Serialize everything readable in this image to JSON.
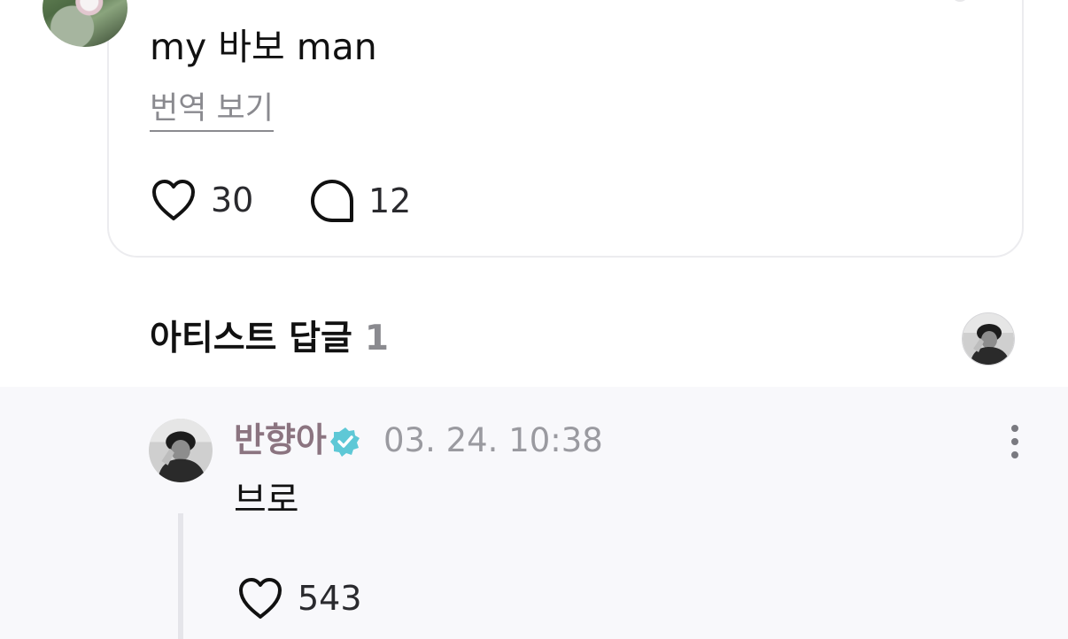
{
  "post": {
    "text": "my 바보 man",
    "translate_label": "번역 보기",
    "like_count": "30",
    "comment_count": "12"
  },
  "artist_reply": {
    "title": "아티스트 답글",
    "count": "1"
  },
  "reply": {
    "author": "반향아",
    "timestamp": "03. 24. 10:38",
    "text": "브로",
    "like_count": "543",
    "verified_color": "#5ec8d6",
    "name_color": "#8b7480"
  },
  "icons": [
    "heart-icon",
    "comment-bubble-icon",
    "verified-badge-icon",
    "more-options-icon"
  ]
}
